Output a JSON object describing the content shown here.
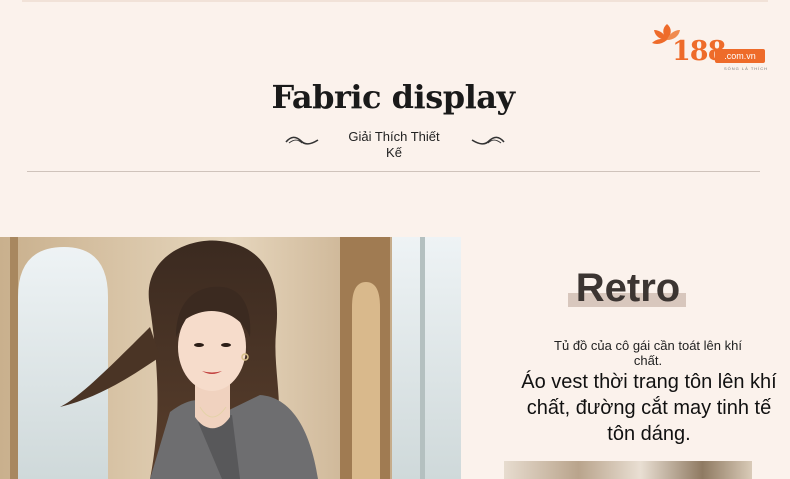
{
  "logo": {
    "number": "188",
    "domain": ".com.vn",
    "tagline": "SỐNG LÀ THÍCH"
  },
  "header": {
    "title": "Fabric display",
    "subtitle": "Giải Thích Thiết Kế"
  },
  "feature": {
    "style_label": "Retro",
    "small_text": "Tủ đồ của cô gái cần toát lên khí chất.",
    "description": "Áo vest thời trang tôn lên khí chất, đường cắt may tinh tế tôn dáng."
  },
  "colors": {
    "background": "#fbf2ec",
    "brand_orange": "#ee6b2a",
    "retro_bar": "#d8c7bd"
  }
}
